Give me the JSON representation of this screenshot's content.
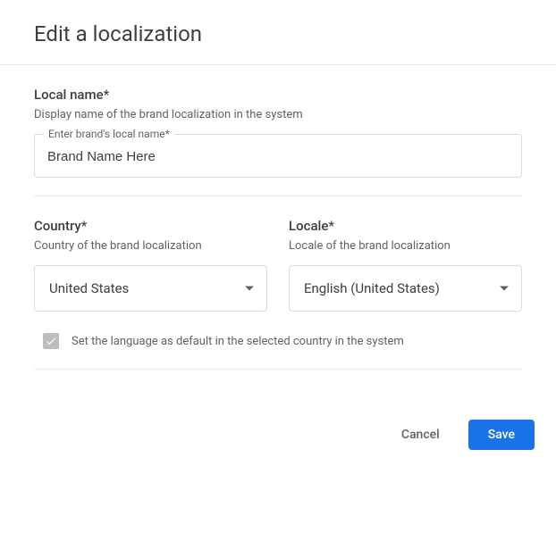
{
  "dialog": {
    "title": "Edit a localization"
  },
  "localName": {
    "label": "Local name*",
    "description": "Display name of the brand localization in the system",
    "fieldLabel": "Enter brand's local name*",
    "value": "Brand Name Here"
  },
  "country": {
    "label": "Country*",
    "description": "Country of the brand localization",
    "selected": "United States"
  },
  "locale": {
    "label": "Locale*",
    "description": "Locale of the brand localization",
    "selected": "English (United States)"
  },
  "defaultLang": {
    "label": "Set the language as default in the selected country in the system",
    "checked": true
  },
  "actions": {
    "cancel": "Cancel",
    "save": "Save"
  }
}
